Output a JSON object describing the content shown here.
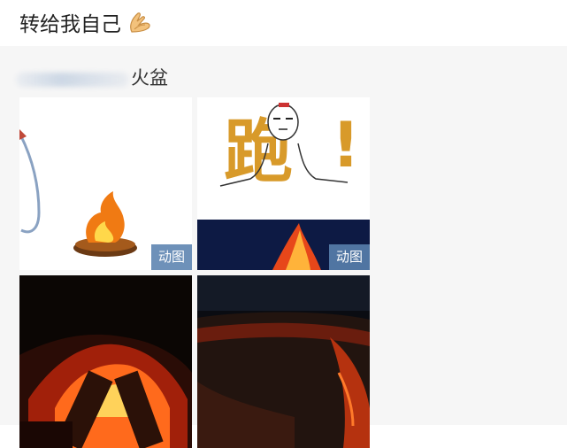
{
  "status": {
    "text": "转给我自己",
    "emoji_icon": "pressed-hands-icon"
  },
  "repost": {
    "author_blurred": true,
    "text": "火盆",
    "images": [
      {
        "kind": "gif",
        "badge": "动图",
        "subject": "fire-pit-emoji"
      },
      {
        "kind": "gif",
        "badge": "动图",
        "subject": "meme-face-and-lava"
      },
      {
        "kind": "gif",
        "subject": "burning-logs"
      },
      {
        "kind": "gif",
        "subject": "night-lava-crater"
      }
    ]
  },
  "colors": {
    "card_bg": "#f6f6f6",
    "badge_bg": "#5a82af"
  }
}
